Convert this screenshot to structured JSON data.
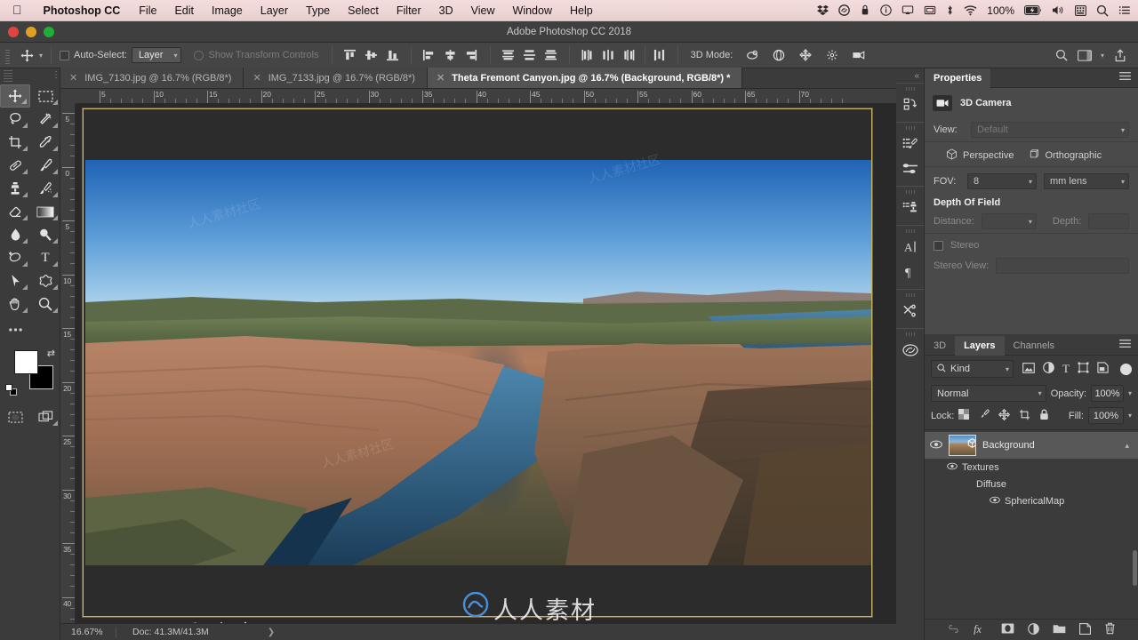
{
  "macbar": {
    "apple_icon": "apple-icon",
    "app_name": "Photoshop CC",
    "menus": [
      "File",
      "Edit",
      "Image",
      "Layer",
      "Type",
      "Select",
      "Filter",
      "3D",
      "View",
      "Window",
      "Help"
    ],
    "status_icons": [
      "dropbox-icon",
      "creative-cloud-icon",
      "backup-icon",
      "info-icon",
      "airplay-icon",
      "display-icon",
      "bluetooth-icon",
      "wifi-icon"
    ],
    "battery_pct": "100%",
    "battery_icon": "battery-charging-icon",
    "volume_icon": "volume-icon",
    "keyboard_icon": "input-menu-icon",
    "search_icon": "spotlight-search-icon",
    "notification_icon": "notification-center-icon"
  },
  "titlebar": {
    "title": "Adobe Photoshop CC 2018"
  },
  "options_bar": {
    "tool_icon": "move-tool-icon",
    "preset_caret": "chevron-down-icon",
    "auto_select_label": "Auto-Select:",
    "auto_select_checked": false,
    "layer_dropdown": "Layer",
    "show_transform_label": "Show Transform Controls",
    "show_transform_enabled": false,
    "align_group_1": [
      "align-top-edges-icon",
      "align-vertical-centers-icon",
      "align-bottom-edges-icon"
    ],
    "align_group_2": [
      "align-left-edges-icon",
      "align-horizontal-centers-icon",
      "align-right-edges-icon"
    ],
    "distribute_group_1": [
      "distribute-top-edges-icon",
      "distribute-vertical-centers-icon",
      "distribute-bottom-edges-icon"
    ],
    "distribute_group_2": [
      "distribute-left-edges-icon",
      "distribute-horizontal-centers-icon",
      "distribute-right-edges-icon"
    ],
    "distribute_spacing": "distribute-spacing-icon",
    "mode_3d_label": "3D Mode:",
    "mode_3d_icons": [
      "rotate-3d-object-icon",
      "roll-3d-object-icon",
      "drag-3d-object-icon",
      "slide-3d-object-icon",
      "scale-3d-object-icon"
    ],
    "right_icons": [
      "search-icon",
      "workspace-icon",
      "workspace-caret-icon",
      "share-icon"
    ]
  },
  "tabs": [
    {
      "label": "IMG_7130.jpg @ 16.7% (RGB/8*)",
      "active": false,
      "close_icon": "close-icon"
    },
    {
      "label": "IMG_7133.jpg @ 16.7% (RGB/8*)",
      "active": false,
      "close_icon": "close-icon"
    },
    {
      "label": "Theta Fremont Canyon.jpg @ 16.7% (Background, RGB/8*) *",
      "active": true,
      "close_icon": "close-icon"
    }
  ],
  "toolbar": {
    "tools": [
      {
        "name": "move-tool-icon",
        "glyph": "✥",
        "selected": true
      },
      {
        "name": "rectangular-marquee-tool-icon",
        "glyph": "⬚",
        "selected": false
      },
      {
        "name": "lasso-tool-icon",
        "glyph": "❀",
        "selected": false
      },
      {
        "name": "magic-wand-tool-icon",
        "glyph": "✦",
        "selected": false
      },
      {
        "name": "crop-tool-icon",
        "glyph": "⌐",
        "selected": false
      },
      {
        "name": "eyedropper-tool-icon",
        "glyph": "✒",
        "selected": false
      },
      {
        "name": "healing-brush-tool-icon",
        "glyph": "✎",
        "selected": false
      },
      {
        "name": "brush-tool-icon",
        "glyph": "✐",
        "selected": false
      },
      {
        "name": "clone-stamp-tool-icon",
        "glyph": "⚑",
        "selected": false
      },
      {
        "name": "history-brush-tool-icon",
        "glyph": "☙",
        "selected": false
      },
      {
        "name": "eraser-tool-icon",
        "glyph": "◢",
        "selected": false
      },
      {
        "name": "gradient-tool-icon",
        "glyph": "■",
        "selected": false
      },
      {
        "name": "blur-tool-icon",
        "glyph": "●",
        "selected": false
      },
      {
        "name": "dodge-tool-icon",
        "glyph": "⚲",
        "selected": false
      },
      {
        "name": "pen-tool-icon",
        "glyph": "✑",
        "selected": false
      },
      {
        "name": "type-tool-icon",
        "glyph": "T",
        "selected": false
      },
      {
        "name": "path-selection-tool-icon",
        "glyph": "➤",
        "selected": false
      },
      {
        "name": "custom-shape-tool-icon",
        "glyph": "★",
        "selected": false
      },
      {
        "name": "hand-tool-icon",
        "glyph": "✋",
        "selected": false
      },
      {
        "name": "zoom-tool-icon",
        "glyph": "⌕",
        "selected": false
      }
    ],
    "more_tools_icon": "edit-toolbar-icon",
    "foreground_color": "#ffffff",
    "background_color": "#000000",
    "swap_icon": "swap-colors-icon",
    "default_colors_icon": "default-colors-icon",
    "quick_mask_icon": "quick-mask-mode-icon",
    "screen_mode_icon": "screen-mode-icon"
  },
  "canvas": {
    "ruler_h_labels": [
      "5",
      "10",
      "15",
      "20",
      "25",
      "30",
      "35",
      "40",
      "45",
      "50",
      "55",
      "60",
      "65",
      "70"
    ],
    "ruler_v_labels": [
      "5",
      "0",
      "5",
      "10",
      "15",
      "20",
      "25",
      "30",
      "35",
      "40"
    ],
    "axis_widget_icons": [
      "orbit-3d-camera-icon",
      "pan-3d-camera-icon",
      "walk-3d-camera-icon"
    ],
    "cursor_icon": "move-cursor-icon",
    "photo_alt": "Fremont Canyon aerial panorama"
  },
  "statusbar": {
    "zoom": "16.67%",
    "doc_info": "Doc: 41.3M/41.3M",
    "expand_icon": "chevron-right-icon"
  },
  "rail": {
    "collapse_icon": "collapse-panels-icon",
    "groups": [
      [
        "history-panel-icon"
      ],
      [
        "brush-settings-icon",
        "brush-presets-icon"
      ],
      [
        "clone-source-icon"
      ],
      [
        "character-panel-icon",
        "paragraph-panel-icon"
      ],
      [
        "tool-presets-icon"
      ],
      [
        "creative-cloud-libraries-icon"
      ]
    ]
  },
  "properties_panel": {
    "tab_label": "Properties",
    "menu_icon": "panel-menu-icon",
    "object_icon": "3d-camera-icon",
    "object_title": "3D Camera",
    "view_label": "View:",
    "view_value": "Default",
    "projection_options": [
      {
        "label": "Perspective",
        "icon": "perspective-cube-icon",
        "selected": true
      },
      {
        "label": "Orthographic",
        "icon": "orthographic-cube-icon",
        "selected": false
      }
    ],
    "fov_label": "FOV:",
    "fov_value": "8",
    "fov_unit": "mm lens",
    "depth_of_field_label": "Depth Of Field",
    "distance_label": "Distance:",
    "distance_value": "",
    "depth_label": "Depth:",
    "depth_value": "",
    "stereo_label": "Stereo",
    "stereo_checked": false,
    "stereo_view_label": "Stereo View:",
    "stereo_view_value": ""
  },
  "layers_panel": {
    "tabs": [
      {
        "label": "3D",
        "active": false
      },
      {
        "label": "Layers",
        "active": true
      },
      {
        "label": "Channels",
        "active": false
      }
    ],
    "menu_icon": "panel-menu-icon",
    "filter_label": "Kind",
    "filter_search_icon": "search-icon",
    "filter_caret": "chevron-down-icon",
    "filter_icons": [
      "filter-pixel-icon",
      "filter-adjustment-icon",
      "filter-type-icon",
      "filter-shape-icon",
      "filter-smart-object-icon"
    ],
    "filter_toggle": "filter-enable-toggle",
    "blend_mode": "Normal",
    "opacity_label": "Opacity:",
    "opacity_value": "100%",
    "lock_label": "Lock:",
    "lock_icons": [
      "lock-transparent-pixels-icon",
      "lock-image-pixels-icon",
      "lock-position-icon",
      "lock-artboard-icon",
      "lock-all-icon"
    ],
    "fill_label": "Fill:",
    "fill_value": "100%",
    "layers": [
      {
        "name": "Background",
        "visible": true,
        "selected": true,
        "expanded": true,
        "thumb": "canyon-thumbnail",
        "badge": "3d-layer-icon",
        "chevron": "chevron-up-icon"
      }
    ],
    "sublayers": [
      {
        "name": "Textures",
        "visible": true,
        "indent": 1
      },
      {
        "name": "Diffuse",
        "visible": false,
        "indent": 2
      },
      {
        "name": "SphericalMap",
        "visible": true,
        "indent": 3
      }
    ],
    "footer_icons": [
      "link-layers-icon",
      "layer-style-icon",
      "layer-mask-icon",
      "adjustment-layer-icon",
      "new-group-icon",
      "new-layer-icon",
      "delete-layer-icon"
    ]
  },
  "watermarks": [
    "人人素材社区",
    "人人素材"
  ]
}
